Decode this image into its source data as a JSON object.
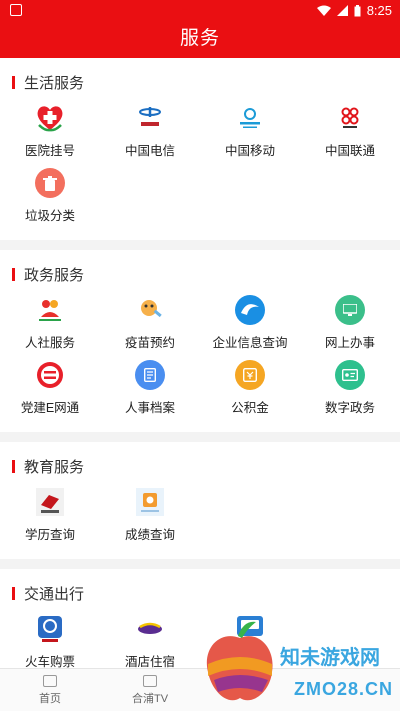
{
  "status": {
    "time": "8:25"
  },
  "header": {
    "title": "服务"
  },
  "sections": [
    {
      "title": "生活服务",
      "items": [
        {
          "label": "医院挂号",
          "icon": "hospital-heart-icon"
        },
        {
          "label": "中国电信",
          "icon": "china-telecom-icon"
        },
        {
          "label": "中国移动",
          "icon": "china-mobile-icon"
        },
        {
          "label": "中国联通",
          "icon": "china-unicom-icon"
        },
        {
          "label": "垃圾分类",
          "icon": "trash-can-icon"
        }
      ]
    },
    {
      "title": "政务服务",
      "items": [
        {
          "label": "人社服务",
          "icon": "social-security-icon"
        },
        {
          "label": "疫苗预约",
          "icon": "vaccine-icon"
        },
        {
          "label": "企业信息查询",
          "icon": "enterprise-query-icon"
        },
        {
          "label": "网上办事",
          "icon": "online-affairs-icon"
        },
        {
          "label": "党建E网通",
          "icon": "party-e-icon"
        },
        {
          "label": "人事档案",
          "icon": "personnel-file-icon"
        },
        {
          "label": "公积金",
          "icon": "housing-fund-icon"
        },
        {
          "label": "数字政务",
          "icon": "digital-gov-icon"
        }
      ]
    },
    {
      "title": "教育服务",
      "items": [
        {
          "label": "学历查询",
          "icon": "degree-query-icon"
        },
        {
          "label": "成绩查询",
          "icon": "score-query-icon"
        }
      ]
    },
    {
      "title": "交通出行",
      "items": [
        {
          "label": "火车购票",
          "icon": "train-ticket-icon"
        },
        {
          "label": "酒店住宿",
          "icon": "hotel-icon"
        },
        {
          "label": "",
          "icon": "bus-icon"
        }
      ]
    }
  ],
  "tabs": [
    {
      "label": "首页",
      "icon": "home-icon"
    },
    {
      "label": "合浦TV",
      "icon": "tv-icon"
    },
    {
      "label": "",
      "icon": "tab-3-icon"
    },
    {
      "label": "",
      "icon": "tab-4-icon"
    }
  ],
  "watermark": {
    "title": "知未游戏网",
    "site": "ZMO28.CN"
  },
  "colors": {
    "primary": "#ea0f12"
  }
}
